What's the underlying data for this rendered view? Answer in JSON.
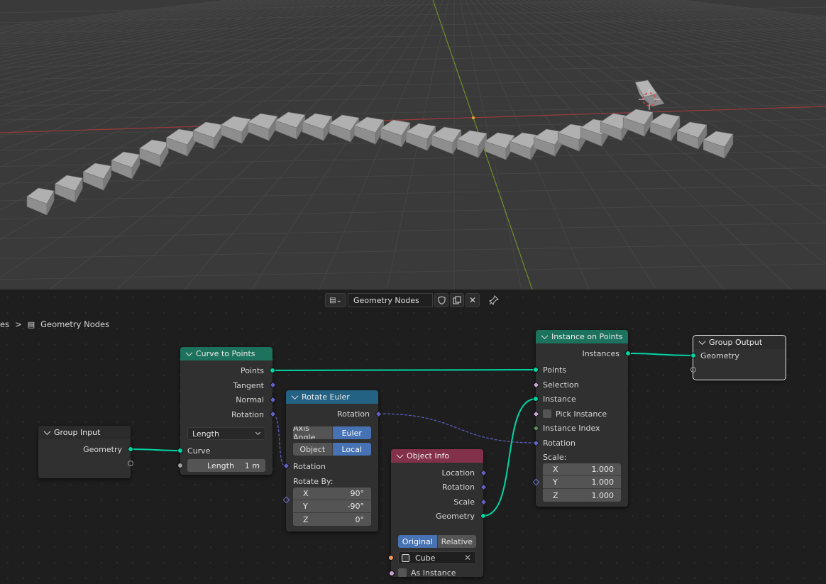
{
  "header": {
    "node_tree_name": "Geometry Nodes",
    "shield_icon": "shield-icon",
    "copy_icon": "duplicate-icon",
    "close_icon": "close-icon",
    "pin_icon": "pin-icon"
  },
  "breadcrumb": {
    "prefix": "es",
    "separator": ">",
    "current": "Geometry Nodes"
  },
  "nodes": {
    "group_input": {
      "title": "Group Input",
      "outputs": [
        "Geometry"
      ]
    },
    "curve_to_points": {
      "title": "Curve to Points",
      "outputs": [
        "Points",
        "Tangent",
        "Normal",
        "Rotation"
      ],
      "mode": "Length",
      "inputs": [
        "Curve"
      ],
      "length_label": "Length",
      "length_value": "1 m"
    },
    "rotate_euler": {
      "title": "Rotate Euler",
      "output": "Rotation",
      "type_options": [
        "Axis Angle",
        "Euler"
      ],
      "space_options": [
        "Object",
        "Local"
      ],
      "input": "Rotation",
      "rotate_by_label": "Rotate By:",
      "rotate_by": [
        {
          "axis": "X",
          "value": "90°"
        },
        {
          "axis": "Y",
          "value": "-90°"
        },
        {
          "axis": "Z",
          "value": "0°"
        }
      ]
    },
    "object_info": {
      "title": "Object Info",
      "outputs": [
        "Location",
        "Rotation",
        "Scale",
        "Geometry"
      ],
      "transform_options": [
        "Original",
        "Relative"
      ],
      "object": "Cube",
      "as_instance": "As Instance"
    },
    "instance_on_points": {
      "title": "Instance on Points",
      "output": "Instances",
      "inputs": [
        "Points",
        "Selection",
        "Instance",
        "Pick Instance",
        "Instance Index",
        "Rotation"
      ],
      "scale_label": "Scale:",
      "scale": [
        {
          "axis": "X",
          "value": "1.000"
        },
        {
          "axis": "Y",
          "value": "1.000"
        },
        {
          "axis": "Z",
          "value": "1.000"
        }
      ]
    },
    "group_output": {
      "title": "Group Output",
      "inputs": [
        "Geometry"
      ]
    }
  },
  "colors": {
    "geometry_socket": "#00d6a3",
    "vector_socket": "#6363c7",
    "header_geometry": "#1d725e",
    "header_vector": "#246283",
    "header_input": "#83314a",
    "active_toggle": "#4772b3"
  }
}
